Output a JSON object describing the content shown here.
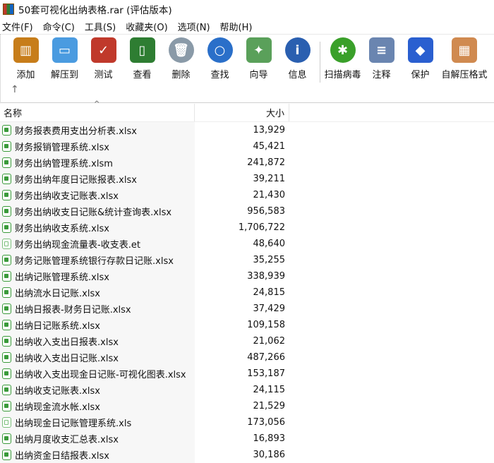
{
  "window": {
    "title": "50套可视化出纳表格.rar (评估版本)"
  },
  "menu": [
    "文件(F)",
    "命令(C)",
    "工具(S)",
    "收藏夹(O)",
    "选项(N)",
    "帮助(H)"
  ],
  "toolbar": [
    {
      "label": "添加",
      "icon": "add-archive-icon",
      "color": "#c77d1a"
    },
    {
      "label": "解压到",
      "icon": "extract-folder-icon",
      "color": "#4a9be0"
    },
    {
      "label": "测试",
      "icon": "test-clipboard-icon",
      "color": "#c0392b"
    },
    {
      "label": "查看",
      "icon": "view-book-icon",
      "color": "#2e7d32"
    },
    {
      "label": "删除",
      "icon": "trash-icon",
      "color": "#8a9aa8"
    },
    {
      "label": "查找",
      "icon": "search-magnifier-icon",
      "color": "#2a6fc9"
    },
    {
      "label": "向导",
      "icon": "wizard-wand-icon",
      "color": "#5aa05a"
    },
    {
      "label": "信息",
      "icon": "info-icon",
      "color": "#2a5fb0"
    },
    {
      "label": "扫描病毒",
      "icon": "virus-scan-icon",
      "color": "#3aa02a"
    },
    {
      "label": "注释",
      "icon": "comment-icon",
      "color": "#6a85b0"
    },
    {
      "label": "保护",
      "icon": "shield-icon",
      "color": "#2a5fd0"
    },
    {
      "label": "自解压格式",
      "icon": "sfx-box-icon",
      "color": "#d08a50"
    }
  ],
  "columns": {
    "name": "名称",
    "size": "大小"
  },
  "files": [
    {
      "name": "财务报表费用支出分析表.xlsx",
      "size": "13,929"
    },
    {
      "name": "财务报销管理系统.xlsx",
      "size": "45,421"
    },
    {
      "name": "财务出纳管理系统.xlsm",
      "size": "241,872"
    },
    {
      "name": "财务出纳年度日记账报表.xlsx",
      "size": "39,211"
    },
    {
      "name": "财务出纳收支记账表.xlsx",
      "size": "21,430"
    },
    {
      "name": "财务出纳收支日记账&统计查询表.xlsx",
      "size": "956,583"
    },
    {
      "name": "财务出纳收支系统.xlsx",
      "size": "1,706,722"
    },
    {
      "name": "财务出纳现金流量表-收支表.et",
      "size": "48,640"
    },
    {
      "name": "财务记账管理系统银行存款日记账.xlsx",
      "size": "35,255"
    },
    {
      "name": "出纳记账管理系统.xlsx",
      "size": "338,939"
    },
    {
      "name": "出纳流水日记账.xlsx",
      "size": "24,815"
    },
    {
      "name": "出纳日报表-财务日记账.xlsx",
      "size": "37,429"
    },
    {
      "name": "出纳日记账系统.xlsx",
      "size": "109,158"
    },
    {
      "name": "出纳收入支出日报表.xlsx",
      "size": "21,062"
    },
    {
      "name": "出纳收入支出日记账.xlsx",
      "size": "487,266"
    },
    {
      "name": "出纳收入支出现金日记账-可视化图表.xlsx",
      "size": "153,187"
    },
    {
      "name": "出纳收支记账表.xlsx",
      "size": "24,115"
    },
    {
      "name": "出纳现金流水帐.xlsx",
      "size": "21,529"
    },
    {
      "name": "出纳现金日记账管理系统.xls",
      "size": "173,056"
    },
    {
      "name": "出纳月度收支汇总表.xlsx",
      "size": "16,893"
    },
    {
      "name": "出纳资金日结报表.xlsx",
      "size": "30,186"
    }
  ]
}
